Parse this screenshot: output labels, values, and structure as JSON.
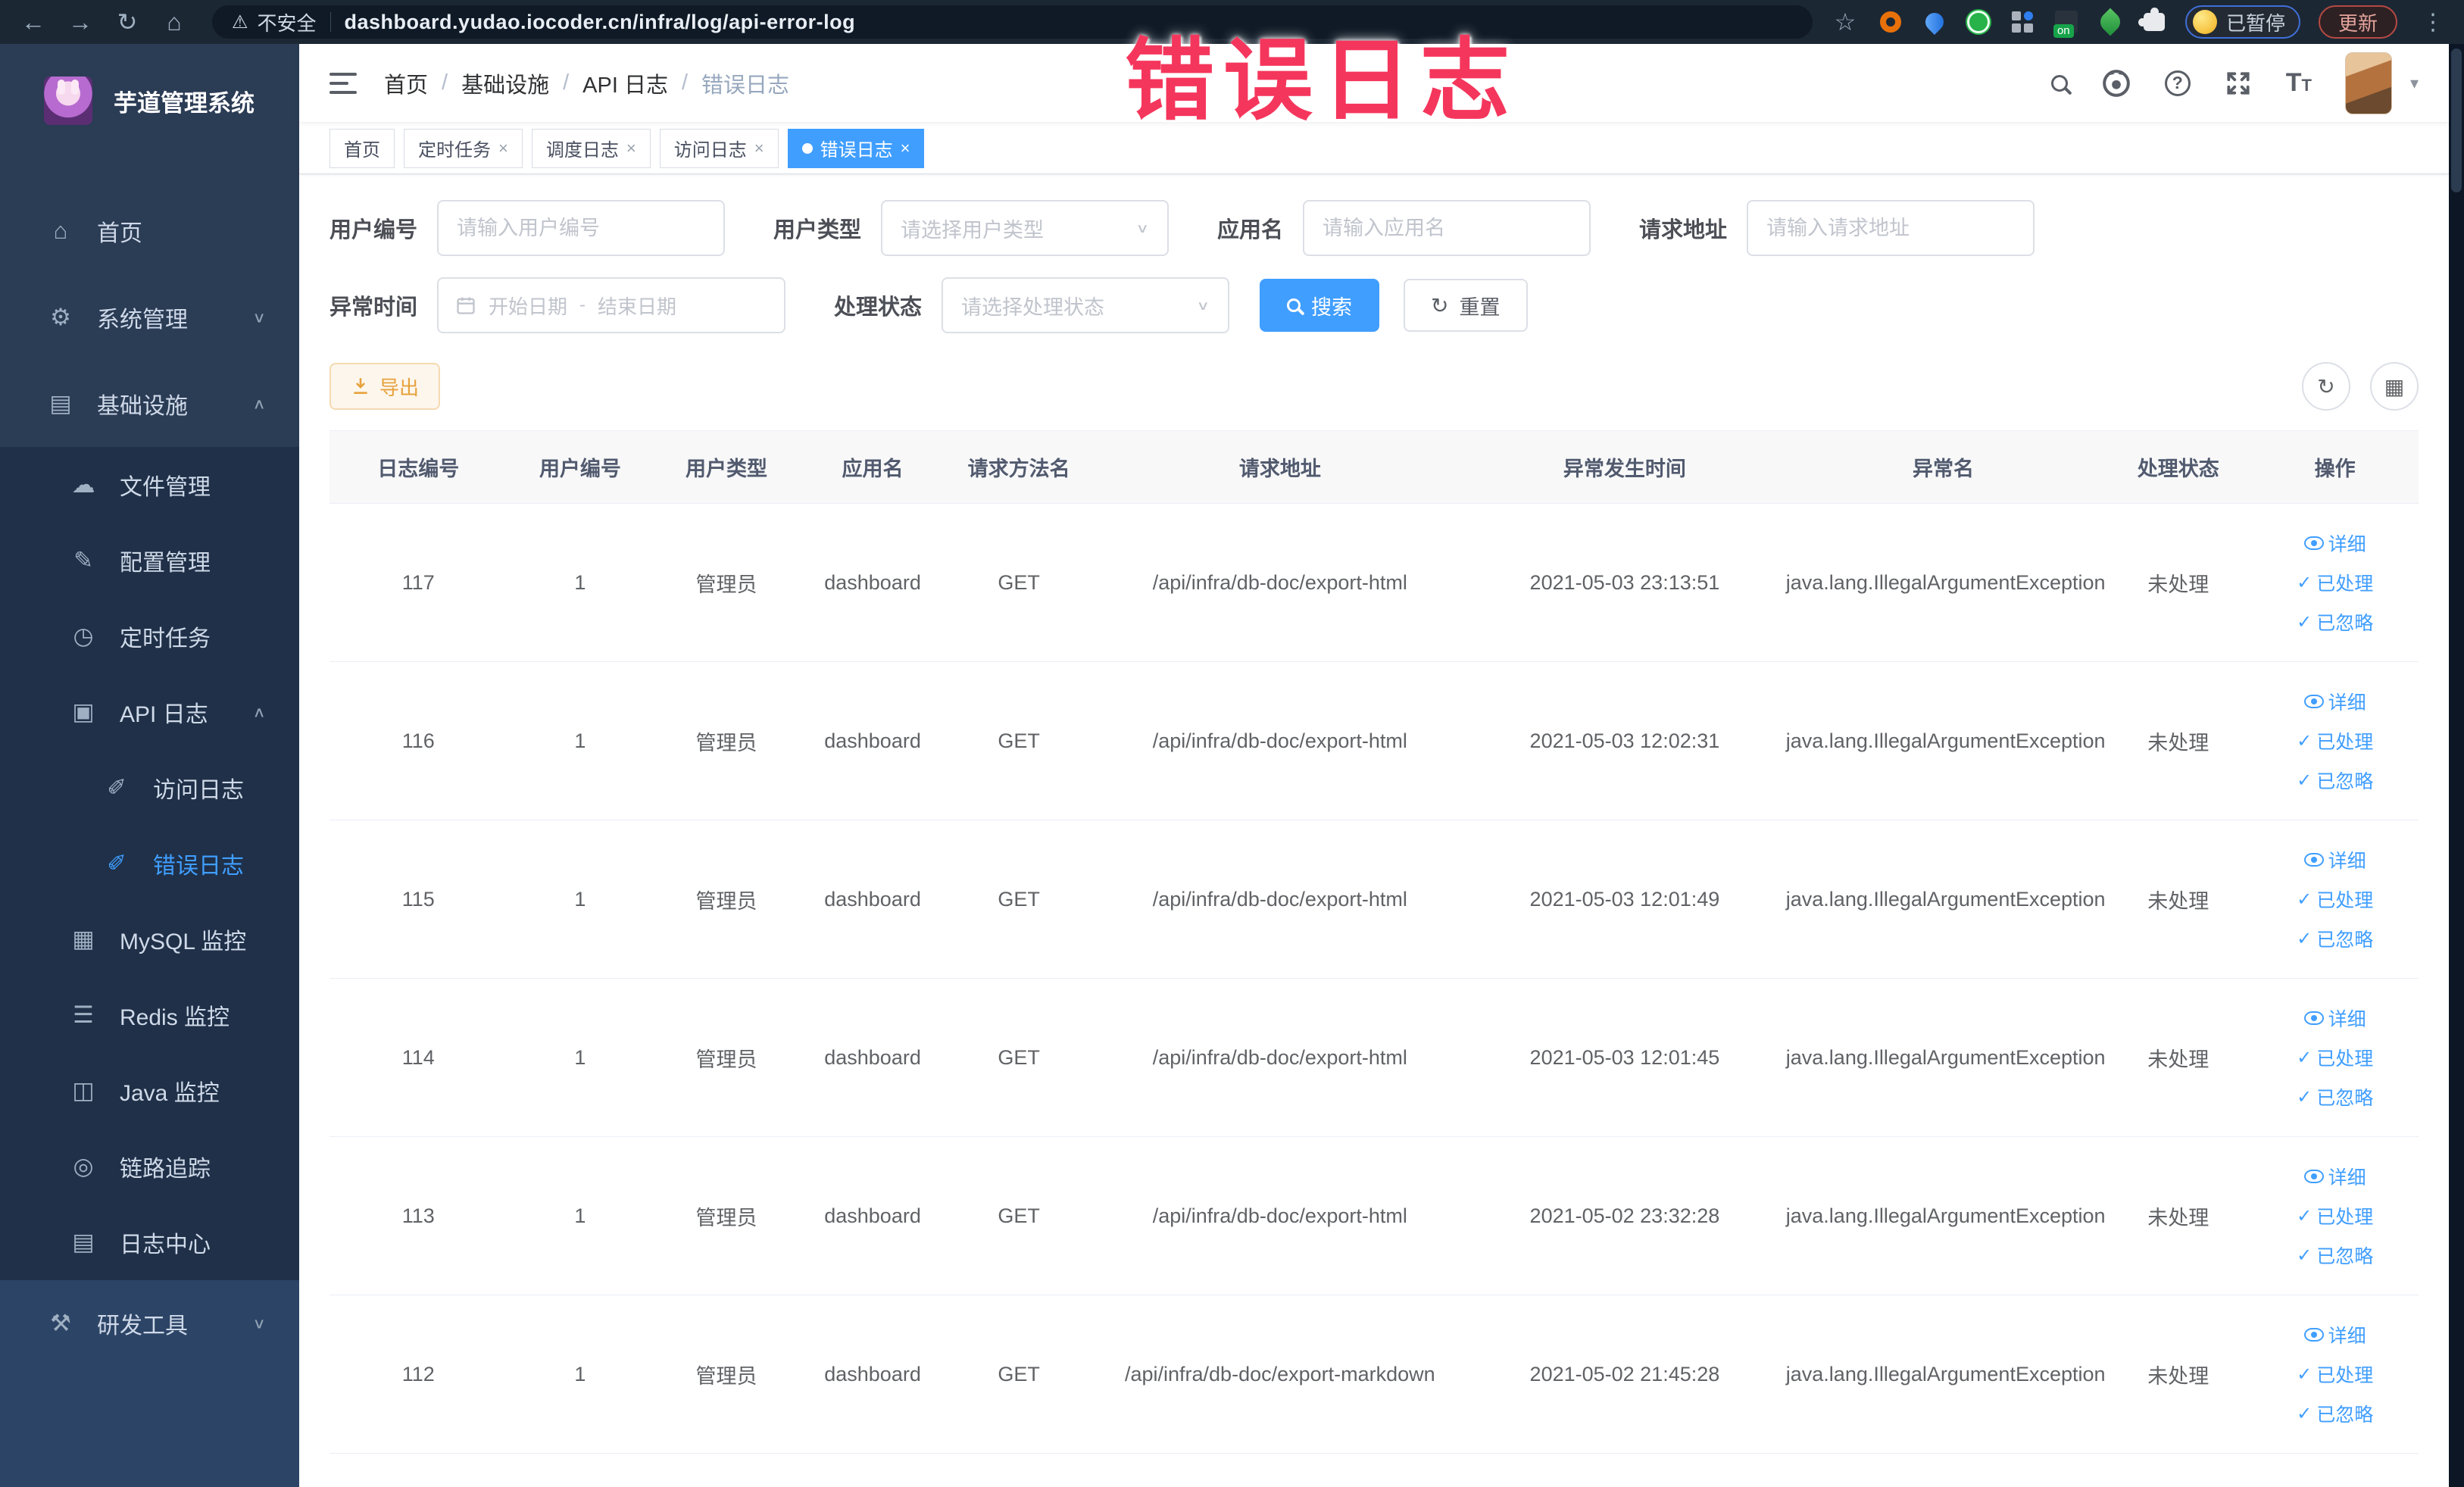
{
  "browser": {
    "security_label": "不安全",
    "url": "dashboard.yudao.iocoder.cn/infra/log/api-error-log",
    "on_badge": "on",
    "paused_badge": "已暂停",
    "update_button": "更新"
  },
  "overlay": {
    "title": "错误日志",
    "color": "#f5365c"
  },
  "sidebar": {
    "app_title": "芋道管理系统",
    "items": [
      {
        "section": "top",
        "type": "m-top",
        "icon": "home-icon",
        "label": "首页"
      },
      {
        "section": "top",
        "type": "m-top",
        "icon": "gear-icon",
        "label": "系统管理",
        "chevron": "down"
      },
      {
        "section": "top",
        "type": "m-top",
        "icon": "infrastructure-icon",
        "label": "基础设施",
        "chevron": "up"
      },
      {
        "section": "sub",
        "type": "m-sub1",
        "icon": "file-cloud-icon",
        "label": "文件管理"
      },
      {
        "section": "sub",
        "type": "m-sub1",
        "icon": "config-edit-icon",
        "label": "配置管理"
      },
      {
        "section": "sub",
        "type": "m-sub1",
        "icon": "timer-icon",
        "label": "定时任务"
      },
      {
        "section": "sub",
        "type": "m-sub1",
        "icon": "api-log-icon",
        "label": "API 日志",
        "chevron": "up"
      },
      {
        "section": "sub",
        "type": "m-sub2",
        "icon": "access-log-icon",
        "label": "访问日志"
      },
      {
        "section": "sub",
        "type": "m-sub2",
        "icon": "error-log-icon",
        "label": "错误日志",
        "active": true
      },
      {
        "section": "sub",
        "type": "m-sub1",
        "icon": "mysql-monitor-icon",
        "label": "MySQL 监控"
      },
      {
        "section": "sub",
        "type": "m-sub1",
        "icon": "redis-monitor-icon",
        "label": "Redis 监控"
      },
      {
        "section": "sub",
        "type": "m-sub1",
        "icon": "java-monitor-icon",
        "label": "Java 监控"
      },
      {
        "section": "sub",
        "type": "m-sub1",
        "icon": "trace-icon",
        "label": "链路追踪"
      },
      {
        "section": "sub",
        "type": "m-sub1",
        "icon": "log-center-icon",
        "label": "日志中心"
      },
      {
        "section": "dev",
        "type": "m-top",
        "icon": "devtools-icon",
        "label": "研发工具",
        "chevron": "down"
      }
    ]
  },
  "header": {
    "breadcrumb": [
      "首页",
      "基础设施",
      "API 日志",
      "错误日志"
    ]
  },
  "tabs": [
    {
      "label": "首页",
      "closable": false,
      "active": false
    },
    {
      "label": "定时任务",
      "closable": true,
      "active": false
    },
    {
      "label": "调度日志",
      "closable": true,
      "active": false
    },
    {
      "label": "访问日志",
      "closable": true,
      "active": false
    },
    {
      "label": "错误日志",
      "closable": true,
      "active": true
    }
  ],
  "filters": {
    "user_id": {
      "label": "用户编号",
      "placeholder": "请输入用户编号"
    },
    "user_type": {
      "label": "用户类型",
      "placeholder": "请选择用户类型"
    },
    "app_name": {
      "label": "应用名",
      "placeholder": "请输入应用名"
    },
    "request_url": {
      "label": "请求地址",
      "placeholder": "请输入请求地址"
    },
    "exception_time": {
      "label": "异常时间",
      "start_placeholder": "开始日期",
      "separator": "-",
      "end_placeholder": "结束日期"
    },
    "process_status": {
      "label": "处理状态",
      "placeholder": "请选择处理状态"
    },
    "search_button": "搜索",
    "reset_button": "重置"
  },
  "toolbar": {
    "export_button": "导出"
  },
  "table": {
    "columns": [
      "日志编号",
      "用户编号",
      "用户类型",
      "应用名",
      "请求方法名",
      "请求地址",
      "异常发生时间",
      "异常名",
      "处理状态",
      "操作"
    ],
    "actions": [
      "详细",
      "已处理",
      "已忽略"
    ],
    "rows": [
      {
        "id": "117",
        "user_id": "1",
        "user_type": "管理员",
        "app_name": "dashboard",
        "method": "GET",
        "url": "/api/infra/db-doc/export-html",
        "time": "2021-05-03 23:13:51",
        "exception": "java.lang.IllegalArgumentException",
        "status": "未处理"
      },
      {
        "id": "116",
        "user_id": "1",
        "user_type": "管理员",
        "app_name": "dashboard",
        "method": "GET",
        "url": "/api/infra/db-doc/export-html",
        "time": "2021-05-03 12:02:31",
        "exception": "java.lang.IllegalArgumentException",
        "status": "未处理"
      },
      {
        "id": "115",
        "user_id": "1",
        "user_type": "管理员",
        "app_name": "dashboard",
        "method": "GET",
        "url": "/api/infra/db-doc/export-html",
        "time": "2021-05-03 12:01:49",
        "exception": "java.lang.IllegalArgumentException",
        "status": "未处理"
      },
      {
        "id": "114",
        "user_id": "1",
        "user_type": "管理员",
        "app_name": "dashboard",
        "method": "GET",
        "url": "/api/infra/db-doc/export-html",
        "time": "2021-05-03 12:01:45",
        "exception": "java.lang.IllegalArgumentException",
        "status": "未处理"
      },
      {
        "id": "113",
        "user_id": "1",
        "user_type": "管理员",
        "app_name": "dashboard",
        "method": "GET",
        "url": "/api/infra/db-doc/export-html",
        "time": "2021-05-02 23:32:28",
        "exception": "java.lang.IllegalArgumentException",
        "status": "未处理"
      },
      {
        "id": "112",
        "user_id": "1",
        "user_type": "管理员",
        "app_name": "dashboard",
        "method": "GET",
        "url": "/api/infra/db-doc/export-markdown",
        "time": "2021-05-02 21:45:28",
        "exception": "java.lang.IllegalArgumentException",
        "status": "未处理"
      }
    ]
  },
  "colors": {
    "primary": "#409eff",
    "warning": "#e6a23c",
    "overlay_red": "#f5365c",
    "sidebar_bg": "#2b3c55"
  }
}
